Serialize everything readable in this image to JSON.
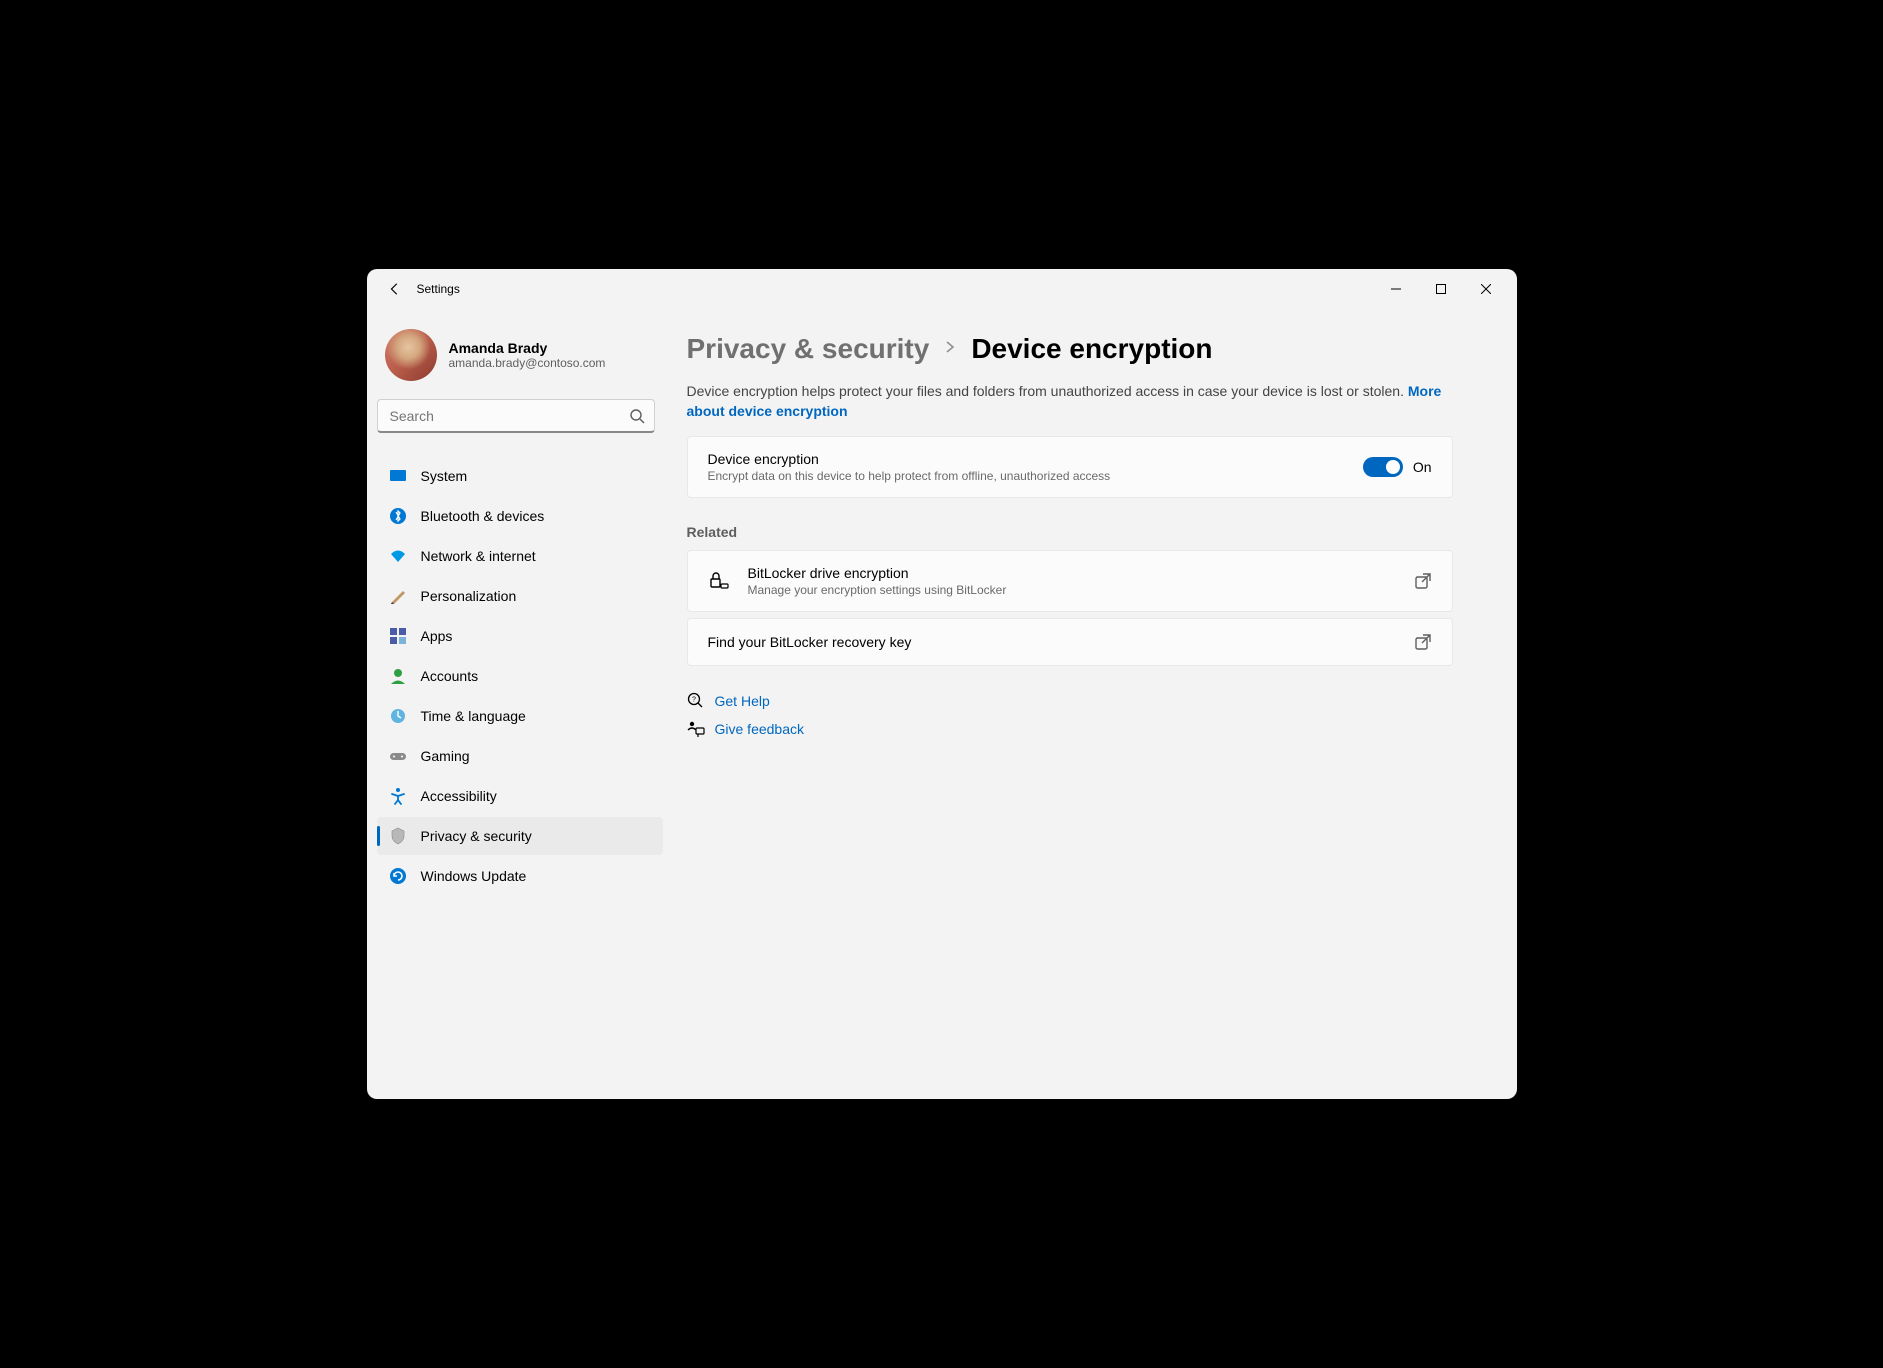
{
  "window": {
    "title": "Settings"
  },
  "profile": {
    "name": "Amanda Brady",
    "email": "amanda.brady@contoso.com"
  },
  "search": {
    "placeholder": "Search"
  },
  "sidebar": {
    "items": [
      {
        "label": "System"
      },
      {
        "label": "Bluetooth & devices"
      },
      {
        "label": "Network & internet"
      },
      {
        "label": "Personalization"
      },
      {
        "label": "Apps"
      },
      {
        "label": "Accounts"
      },
      {
        "label": "Time & language"
      },
      {
        "label": "Gaming"
      },
      {
        "label": "Accessibility"
      },
      {
        "label": "Privacy & security"
      },
      {
        "label": "Windows Update"
      }
    ]
  },
  "breadcrumb": {
    "section": "Privacy & security",
    "page": "Device encryption"
  },
  "description": {
    "text": "Device encryption helps protect your files and folders from unauthorized access in case your device is lost or stolen. ",
    "link": "More about device encryption"
  },
  "encryption_card": {
    "title": "Device encryption",
    "subtitle": "Encrypt data on this device to help protect from offline, unauthorized access",
    "toggle_state": "On"
  },
  "related": {
    "heading": "Related",
    "items": [
      {
        "title": "BitLocker drive encryption",
        "subtitle": "Manage your encryption settings using BitLocker"
      },
      {
        "title": "Find your BitLocker recovery key"
      }
    ]
  },
  "footer": {
    "help": "Get Help",
    "feedback": "Give feedback"
  }
}
